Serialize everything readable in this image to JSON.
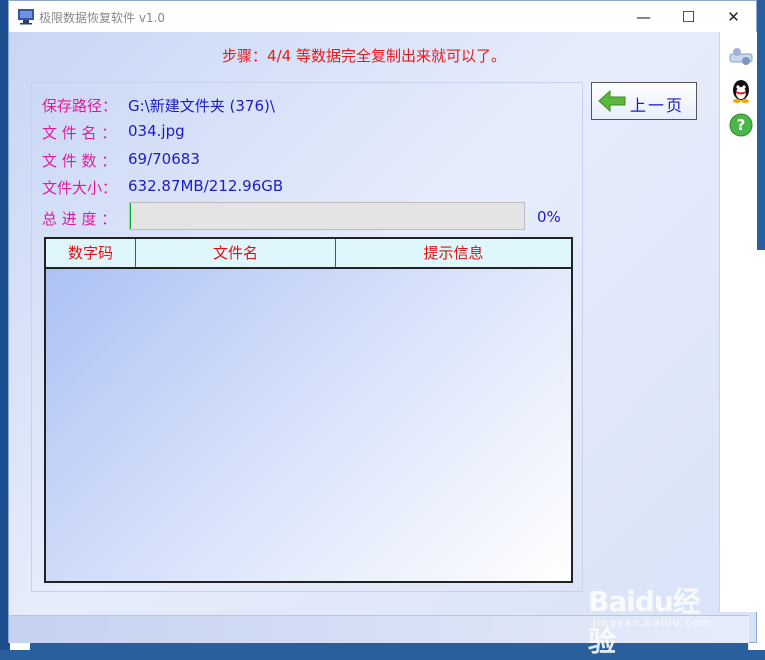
{
  "window": {
    "title": "极限数据恢复软件 v1.0",
    "minimize_glyph": "—",
    "maximize_glyph": "☐",
    "close_glyph": "✕"
  },
  "step_text": "步骤：4/4 等数据完全复制出来就可以了。",
  "info": {
    "path_label": "保存路径：",
    "path_value": "G:\\新建文件夹 (376)\\",
    "filename_label": "文 件 名 ：",
    "filename_value": "034.jpg",
    "count_label": "文 件 数 ：",
    "count_value": "69/70683",
    "size_label": "文件大小：",
    "size_value": "632.87MB/212.96GB",
    "progress_label": "总 进 度 ："
  },
  "progress": {
    "percent_text": "0%",
    "fraction": 0.003
  },
  "table": {
    "columns": [
      "数字码",
      "文件名",
      "提示信息"
    ],
    "rows": []
  },
  "back_button": {
    "label": "上一页"
  },
  "side_icons": [
    "network-icon",
    "qq-penguin-icon",
    "help-icon"
  ],
  "watermark": {
    "logo_text": "Baidu经验",
    "url": "jingyan.baidu.com"
  },
  "colors": {
    "step_text": "#e81919",
    "label": "#e11aa0",
    "value": "#1c1cc8",
    "header_text": "#e01010",
    "progress_fill": "#06b025"
  }
}
